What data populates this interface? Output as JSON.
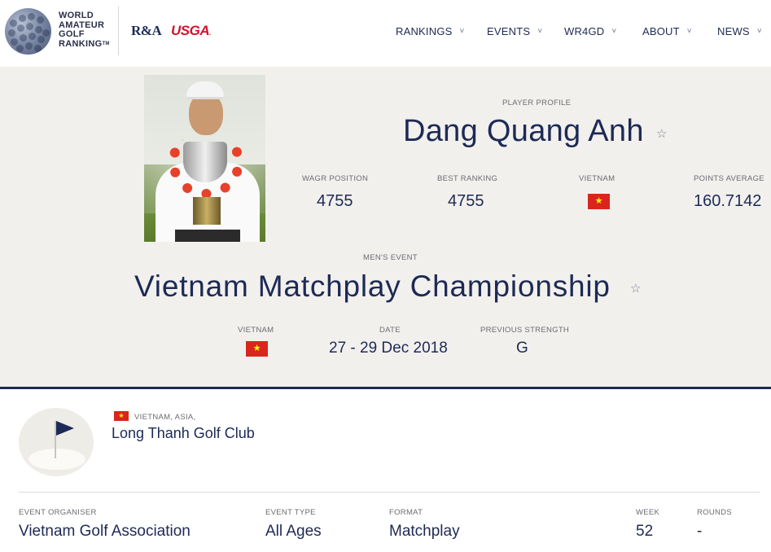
{
  "brand": {
    "logo_lines": [
      "WORLD",
      "AMATEUR",
      "GOLF",
      "RANKING"
    ],
    "trademark": "TM",
    "partner1": "R&A",
    "partner2": "USGA",
    "partner2_dot": "."
  },
  "nav": [
    {
      "label": "RANKINGS"
    },
    {
      "label": "EVENTS"
    },
    {
      "label": "WR4GD"
    },
    {
      "label": "ABOUT"
    },
    {
      "label": "NEWS"
    }
  ],
  "player": {
    "section_label": "PLAYER PROFILE",
    "name": "Dang Quang Anh",
    "stats": [
      {
        "label": "WAGR POSITION",
        "value": "4755"
      },
      {
        "label": "BEST RANKING",
        "value": "4755"
      },
      {
        "label": "VIETNAM",
        "value": ""
      },
      {
        "label": "POINTS AVERAGE",
        "value": "160.7142"
      }
    ]
  },
  "event": {
    "category": "MEN'S EVENT",
    "title": "Vietnam Matchplay Championship",
    "meta": [
      {
        "label": "VIETNAM",
        "value": ""
      },
      {
        "label": "DATE",
        "value": "27 - 29 Dec 2018"
      },
      {
        "label": "PREVIOUS STRENGTH",
        "value": "G"
      }
    ]
  },
  "venue": {
    "location": "VIETNAM, ASIA,",
    "club": "Long Thanh Golf Club"
  },
  "details": [
    {
      "label": "EVENT ORGANISER",
      "value": "Vietnam Golf Association"
    },
    {
      "label": "EVENT TYPE",
      "value": "All Ages"
    },
    {
      "label": "FORMAT",
      "value": "Matchplay"
    },
    {
      "label": "WEEK",
      "value": "52"
    },
    {
      "label": "ROUNDS",
      "value": "-"
    }
  ],
  "icons": {
    "star": "☆",
    "chevron": "˅"
  },
  "colors": {
    "navy": "#1d2a55",
    "band": "#f2f0ed",
    "usga_red": "#d3122e",
    "vietnam_red": "#da251d",
    "vietnam_star": "#ffff00"
  }
}
